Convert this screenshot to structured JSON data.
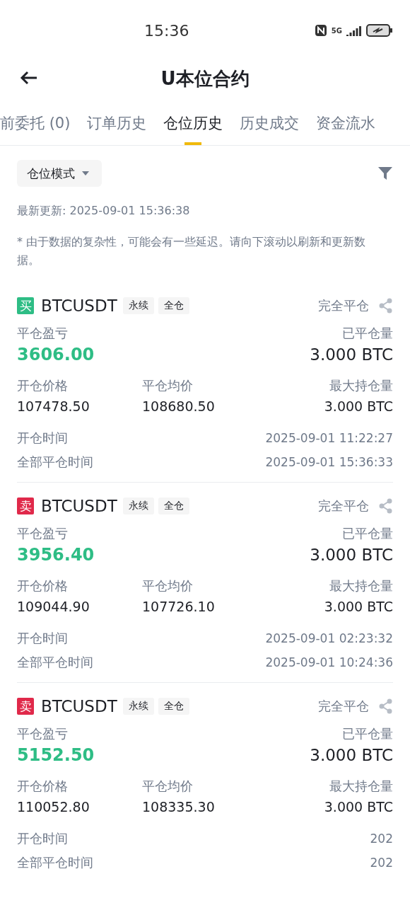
{
  "status_bar": {
    "time": "15:36",
    "network": "5G"
  },
  "header": {
    "title": "U本位合约"
  },
  "tabs": [
    {
      "label": "前委托 (0)",
      "selected": false
    },
    {
      "label": "订单历史",
      "selected": false
    },
    {
      "label": "仓位历史",
      "selected": true
    },
    {
      "label": "历史成交",
      "selected": false
    },
    {
      "label": "资金流水",
      "selected": false
    }
  ],
  "mode_dropdown": {
    "label": "仓位模式"
  },
  "last_update": "最新更新: 2025-09-01 15:36:38",
  "note": "* 由于数据的复杂性，可能会有一些延迟。请向下滚动以刷新和更新数据。",
  "positions": [
    {
      "side": "买",
      "color": "#2ebd85",
      "symbol": "BTCUSDT",
      "tags": [
        "永续",
        "全仓"
      ],
      "status": "完全平仓",
      "pnl_label": "平仓盈亏",
      "pnl": "3606.00",
      "closed_label": "已平仓量",
      "closed": "3.000 BTC",
      "open_price_label": "开仓价格",
      "open_price": "107478.50",
      "close_price_label": "平仓均价",
      "close_price": "108680.50",
      "max_label": "最大持仓量",
      "max": "3.000 BTC",
      "open_time_label": "开仓时间",
      "open_time": "2025-09-01 11:22:27",
      "close_time_label": "全部平仓时间",
      "close_time": "2025-09-01 15:36:33"
    },
    {
      "side": "卖",
      "color": "#e0294a",
      "symbol": "BTCUSDT",
      "tags": [
        "永续",
        "全仓"
      ],
      "status": "完全平仓",
      "pnl_label": "平仓盈亏",
      "pnl": "3956.40",
      "closed_label": "已平仓量",
      "closed": "3.000 BTC",
      "open_price_label": "开仓价格",
      "open_price": "109044.90",
      "close_price_label": "平仓均价",
      "close_price": "107726.10",
      "max_label": "最大持仓量",
      "max": "3.000 BTC",
      "open_time_label": "开仓时间",
      "open_time": "2025-09-01 02:23:32",
      "close_time_label": "全部平仓时间",
      "close_time": "2025-09-01 10:24:36"
    },
    {
      "side": "卖",
      "color": "#e0294a",
      "symbol": "BTCUSDT",
      "tags": [
        "永续",
        "全仓"
      ],
      "status": "完全平仓",
      "pnl_label": "平仓盈亏",
      "pnl": "5152.50",
      "closed_label": "已平仓量",
      "closed": "3.000 BTC",
      "open_price_label": "开仓价格",
      "open_price": "110052.80",
      "close_price_label": "平仓均价",
      "close_price": "108335.30",
      "max_label": "最大持仓量",
      "max": "3.000 BTC",
      "open_time_label": "开仓时间",
      "open_time": "202",
      "close_time_label": "全部平仓时间",
      "close_time": "202"
    }
  ]
}
